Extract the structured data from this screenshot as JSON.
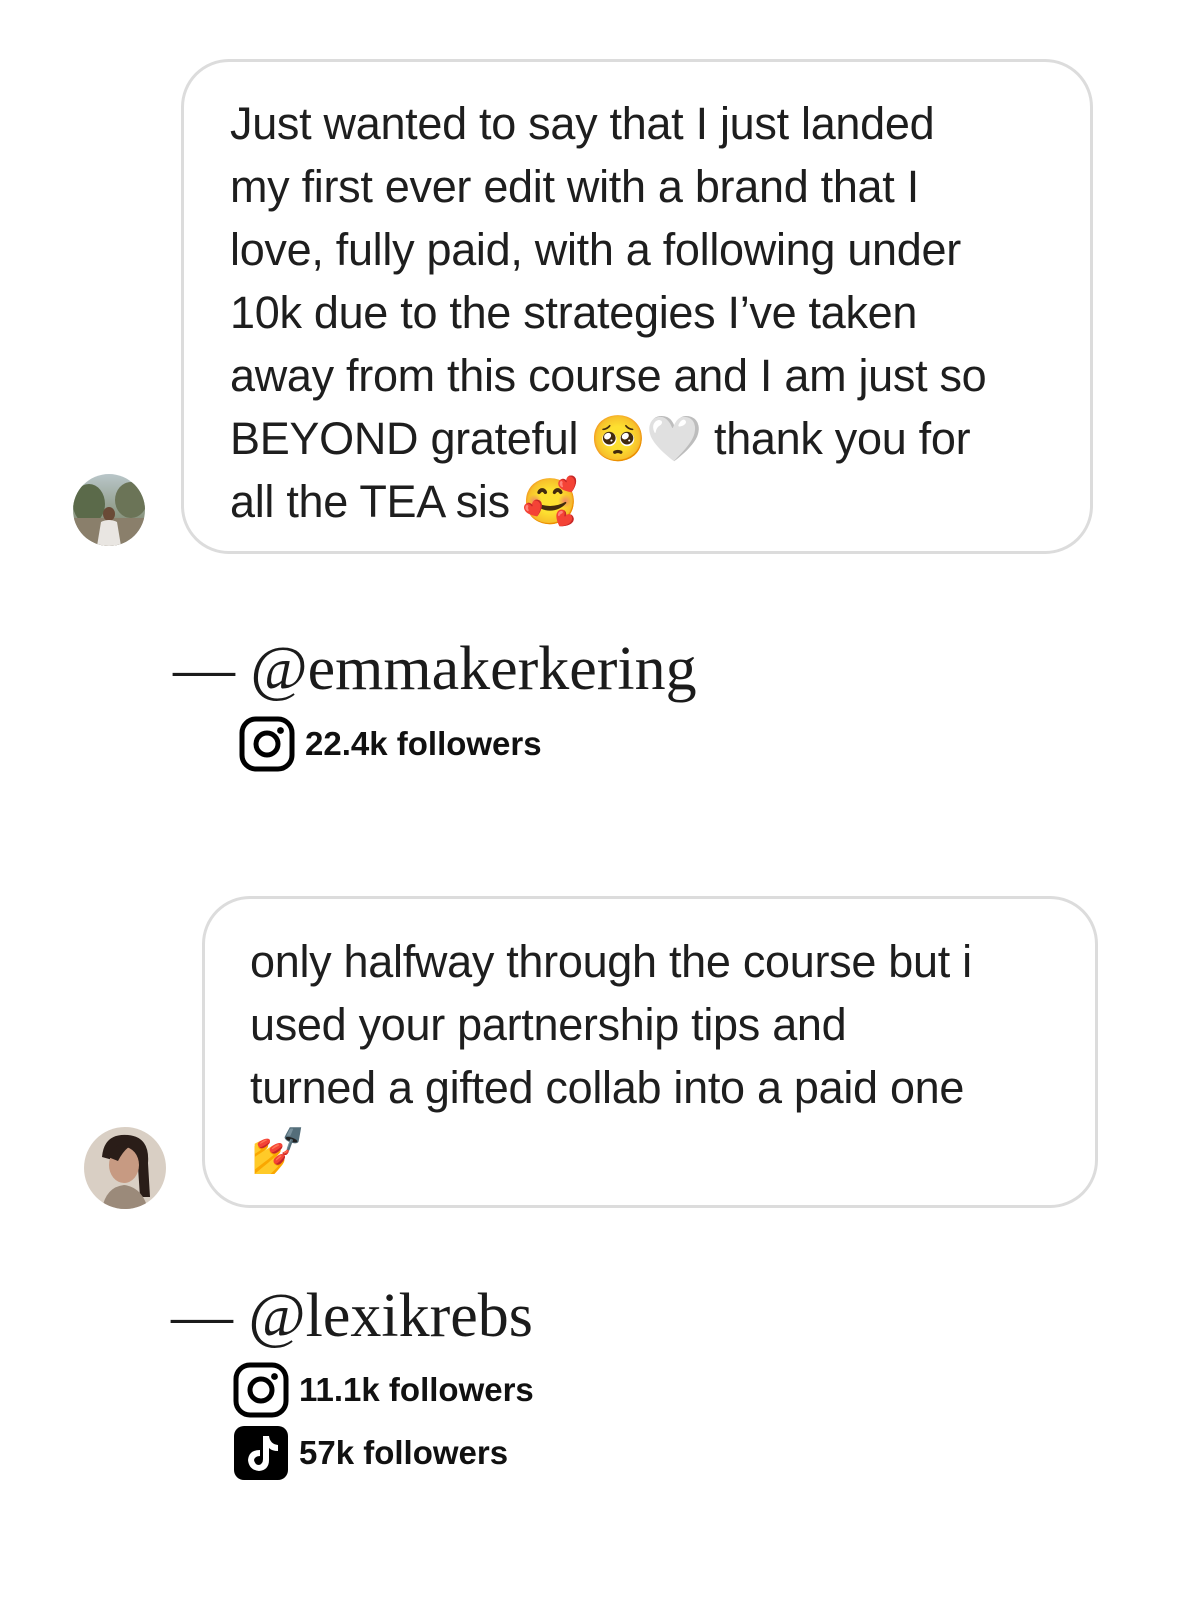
{
  "testimonials": [
    {
      "message": "Just wanted to say that I just landed\nmy first ever edit with a brand that I\nlove, fully paid, with a following under\n10k due to the strategies I’ve taken\naway from this course and I am just so\nBEYOND grateful 🥺🤍 thank you for\nall the TEA sis 🥰",
      "handle": "— @emmakerkering",
      "stats": [
        {
          "icon": "instagram-icon",
          "text": "22.4k followers"
        }
      ]
    },
    {
      "message": "only halfway through the course but i\nused your partnership tips and\nturned a gifted collab into a paid one\n💅",
      "handle": "— @lexikrebs",
      "stats": [
        {
          "icon": "instagram-icon",
          "text": "11.1k followers"
        },
        {
          "icon": "tiktok-icon",
          "text": "57k followers"
        }
      ]
    }
  ]
}
